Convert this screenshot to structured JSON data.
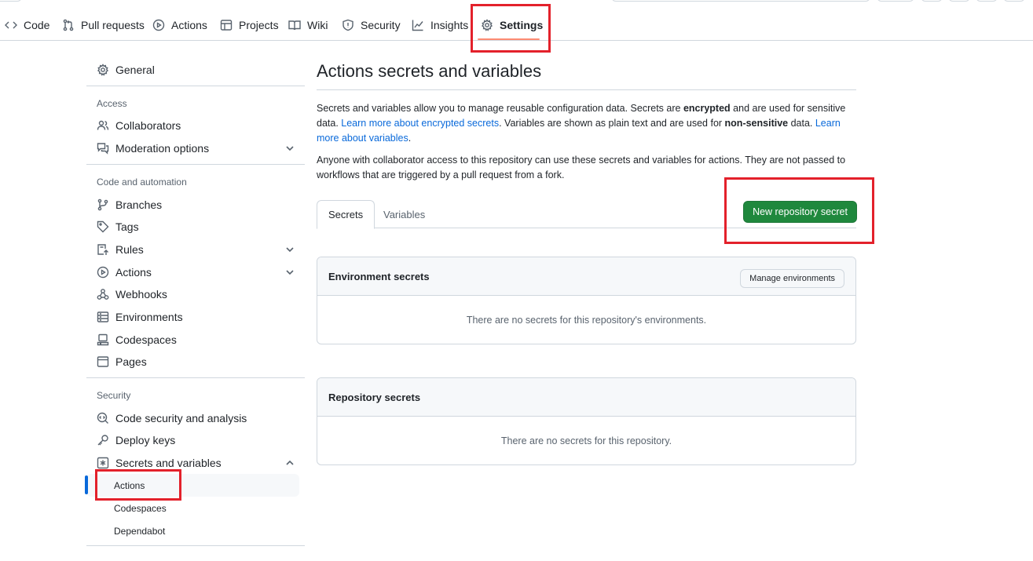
{
  "repo_nav": {
    "tabs": [
      {
        "label": "Code",
        "icon": "code-icon"
      },
      {
        "label": "Pull requests",
        "icon": "git-pull-request-icon"
      },
      {
        "label": "Actions",
        "icon": "play-icon"
      },
      {
        "label": "Projects",
        "icon": "table-icon"
      },
      {
        "label": "Wiki",
        "icon": "book-icon"
      },
      {
        "label": "Security",
        "icon": "shield-icon"
      },
      {
        "label": "Insights",
        "icon": "graph-icon"
      },
      {
        "label": "Settings",
        "icon": "gear-icon"
      }
    ],
    "active_tab": "Settings"
  },
  "sidebar": {
    "general": "General",
    "access_heading": "Access",
    "collaborators": "Collaborators",
    "moderation": "Moderation options",
    "code_heading": "Code and automation",
    "branches": "Branches",
    "tags": "Tags",
    "rules": "Rules",
    "actions": "Actions",
    "webhooks": "Webhooks",
    "environments": "Environments",
    "codespaces": "Codespaces",
    "pages": "Pages",
    "security_heading": "Security",
    "code_security": "Code security and analysis",
    "deploy_keys": "Deploy keys",
    "secrets_vars": "Secrets and variables",
    "sub_items": [
      "Actions",
      "Codespaces",
      "Dependabot"
    ],
    "active_sub": "Actions"
  },
  "main": {
    "title": "Actions secrets and variables",
    "intro": {
      "t1": "Secrets and variables allow you to manage reusable configuration data. Secrets are ",
      "b1": "encrypted",
      "t2": " and are used for sensitive data. ",
      "link1": "Learn more about encrypted secrets",
      "t3": ". Variables are shown as plain text and are used for ",
      "b2": "non-sensitive",
      "t4": " data. ",
      "link2": "Learn more about variables",
      "t5": "."
    },
    "notice": "Anyone with collaborator access to this repository can use these secrets and variables for actions. They are not passed to workflows that are triggered by a pull request from a fork.",
    "tabs": [
      "Secrets",
      "Variables"
    ],
    "active_tab": "Secrets",
    "new_secret_button": "New repository secret",
    "env_box": {
      "title": "Environment secrets",
      "button": "Manage environments",
      "empty": "There are no secrets for this repository's environments."
    },
    "repo_box": {
      "title": "Repository secrets",
      "empty": "There are no secrets for this repository."
    }
  },
  "colors": {
    "primary_button": "#1f883d",
    "link": "#0969da",
    "highlight": "#e3212b",
    "active_underline": "#fd8c73"
  }
}
